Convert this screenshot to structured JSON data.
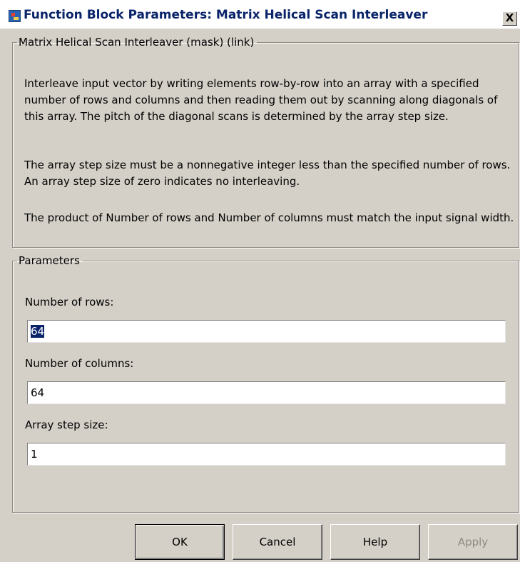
{
  "window": {
    "title": "Function Block Parameters: Matrix Helical Scan Interleaver",
    "close_label": "X"
  },
  "description_group": {
    "legend": "Matrix Helical Scan Interleaver (mask) (link)",
    "paragraphs": [
      "Interleave input vector by writing elements row-by-row into an array with a specified number of rows and columns and then reading them out by scanning along diagonals of this array.  The pitch of the diagonal scans is determined by the array step size.",
      "The array step size must be a nonnegative integer less than the specified number of rows.  An array step size of zero indicates no interleaving.",
      "The product of Number of rows and Number of columns must match the input signal width."
    ]
  },
  "parameters": {
    "legend": "Parameters",
    "rows": {
      "label": "Number of rows:",
      "value": "64"
    },
    "columns": {
      "label": "Number of columns:",
      "value": "64"
    },
    "step": {
      "label": "Array step size:",
      "value": "1"
    }
  },
  "buttons": {
    "ok": "OK",
    "cancel": "Cancel",
    "help": "Help",
    "apply": "Apply"
  }
}
